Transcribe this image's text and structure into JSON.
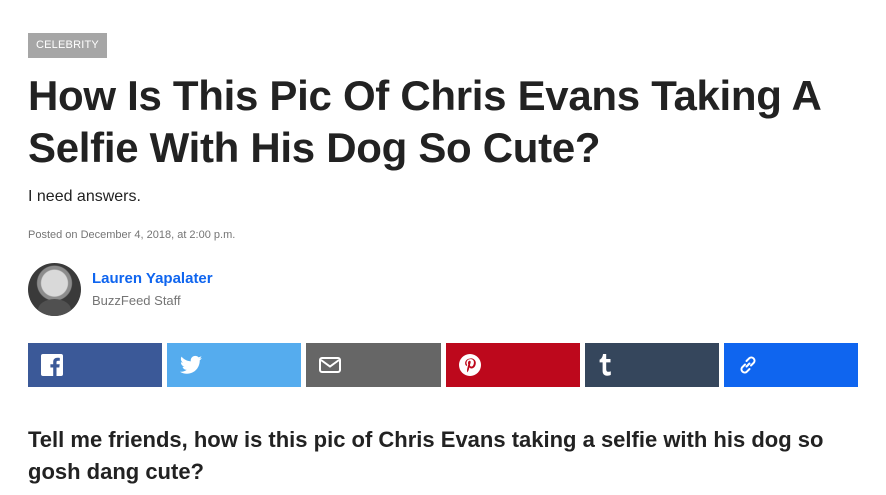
{
  "article": {
    "category": "CELEBRITY",
    "headline": "How Is This Pic Of Chris Evans Taking A Selfie With His Dog So Cute?",
    "dek": "I need answers.",
    "posted": "Posted on December 4, 2018, at 2:00 p.m.",
    "author": {
      "name": "Lauren Yapalater",
      "role": "BuzzFeed Staff"
    },
    "body": "Tell me friends, how is this pic of Chris Evans taking a selfie with his dog so gosh dang cute?"
  },
  "share": {
    "buttons": [
      {
        "id": "facebook",
        "icon": "facebook-icon",
        "color": "#3b5998"
      },
      {
        "id": "twitter",
        "icon": "twitter-icon",
        "color": "#55acee"
      },
      {
        "id": "email",
        "icon": "email-icon",
        "color": "#666666"
      },
      {
        "id": "pinterest",
        "icon": "pinterest-icon",
        "color": "#bd081c"
      },
      {
        "id": "tumblr",
        "icon": "tumblr-icon",
        "color": "#35465c"
      },
      {
        "id": "link",
        "icon": "link-icon",
        "color": "#0f65ef"
      }
    ]
  }
}
